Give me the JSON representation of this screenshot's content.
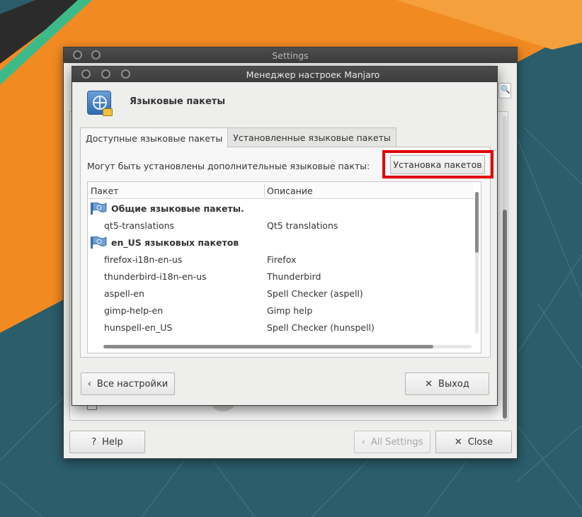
{
  "outer_window": {
    "title": "Settings",
    "help_label": "Help",
    "help_icon": "?",
    "all_settings_label": "All Settings",
    "back_icon": "‹",
    "close_label": "Close",
    "close_icon": "✕",
    "search_icon": "🔍"
  },
  "inner_window": {
    "title": "Менеджер настроек Manjaro",
    "header_title": "Языковые пакеты",
    "tabs": [
      {
        "label": "Доступные языковые пакеты",
        "active": true
      },
      {
        "label": "Установленные языковые пакеты",
        "active": false
      }
    ],
    "info_text": "Могут быть установлены дополнительные языковые пакты:",
    "install_button": "Установка пакетов",
    "table": {
      "columns": [
        "Пакет",
        "Описание"
      ],
      "rows": [
        {
          "type": "group",
          "package": "Общие языковые пакеты.",
          "description": ""
        },
        {
          "type": "item",
          "package": "qt5-translations",
          "description": "Qt5 translations"
        },
        {
          "type": "group",
          "package": "en_US языковых пакетов",
          "description": ""
        },
        {
          "type": "item",
          "package": "firefox-i18n-en-us",
          "description": "Firefox"
        },
        {
          "type": "item",
          "package": "thunderbird-i18n-en-us",
          "description": "Thunderbird"
        },
        {
          "type": "item",
          "package": "aspell-en",
          "description": "Spell Checker (aspell)"
        },
        {
          "type": "item",
          "package": "gimp-help-en",
          "description": "Gimp help"
        },
        {
          "type": "item",
          "package": "hunspell-en_US",
          "description": "Spell Checker (hunspell)"
        }
      ]
    },
    "all_settings_button": "Все настройки",
    "exit_button": "Выход",
    "back_icon": "‹",
    "exit_icon": "✕"
  },
  "colors": {
    "highlight": "#e00000",
    "desktop_orange": "#f07f1e",
    "desktop_teal": "#2f5e6b"
  }
}
